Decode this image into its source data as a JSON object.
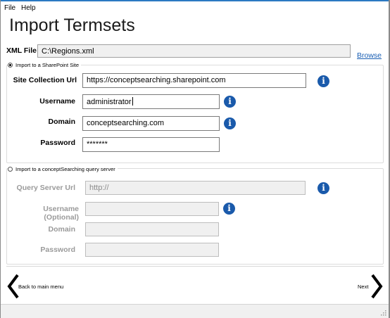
{
  "menu": {
    "file": "File",
    "help": "Help"
  },
  "title": "Import Termsets",
  "xml_file": {
    "label": "XML File:",
    "value": "C:\\Regions.xml",
    "browse": "Browse"
  },
  "sharepoint": {
    "option_label": "Import to a SharePoint Site",
    "selected": true,
    "site_url_label": "Site Collection Url",
    "site_url_value": "https://conceptsearching.sharepoint.com",
    "username_label": "Username",
    "username_value": "administrator",
    "domain_label": "Domain",
    "domain_value": "conceptsearching.com",
    "password_label": "Password",
    "password_value": "*******"
  },
  "query_server": {
    "option_label": "Import to a conceptSearching query server",
    "selected": false,
    "url_label": "Query Server Url",
    "url_value": "http://",
    "username_label": "Username (Optional)",
    "username_value": "",
    "domain_label": "Domain",
    "domain_value": "",
    "password_label": "Password",
    "password_value": ""
  },
  "navigation": {
    "back_label": "Back to main menu",
    "next_label": "Next"
  },
  "colors": {
    "info_icon": "#1a5aab",
    "link": "#1a5fb4",
    "title_bar_accent": "#2b79c2"
  }
}
